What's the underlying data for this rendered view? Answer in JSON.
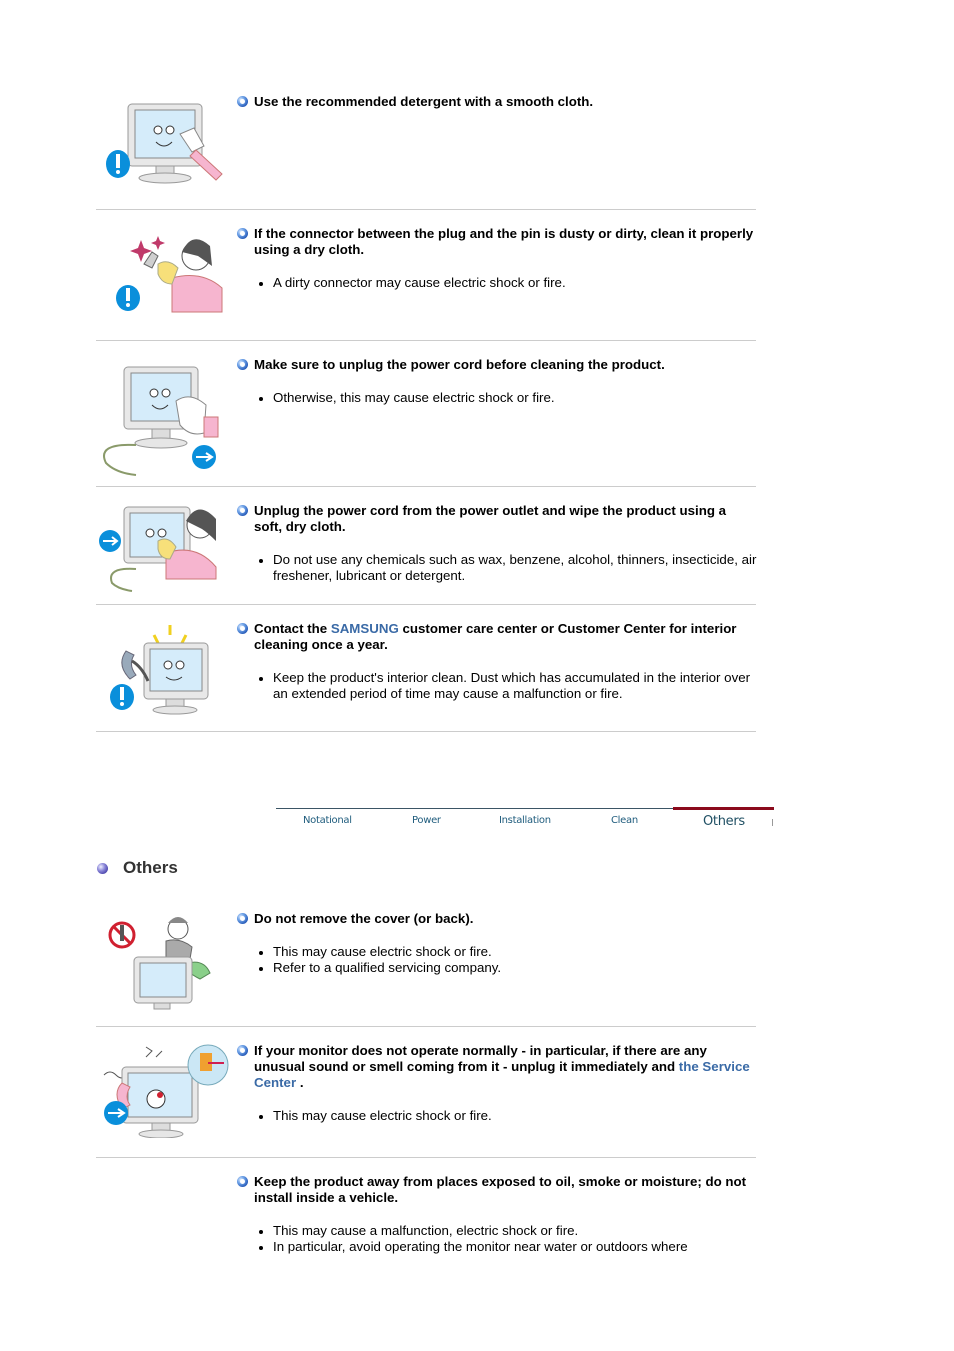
{
  "clean_sections": [
    {
      "illustration": "monitor-wiping-warning-icon",
      "heading_parts": [
        {
          "text": "Use the recommended detergent with a smooth cloth.",
          "link": false
        }
      ],
      "items": []
    },
    {
      "illustration": "woman-cleaning-plug-warning-icon",
      "heading_parts": [
        {
          "text": "If the connector between the plug and the pin is dusty or dirty, clean it properly using a dry cloth.",
          "link": false
        }
      ],
      "items": [
        "A dirty connector may cause electric shock or fire."
      ]
    },
    {
      "illustration": "monitor-unplug-cleaning-icon",
      "heading_parts": [
        {
          "text": "Make sure to unplug the power cord before cleaning the product.",
          "link": false
        }
      ],
      "items": [
        "Otherwise, this may cause electric shock or fire."
      ]
    },
    {
      "illustration": "woman-wiping-monitor-unplug-icon",
      "heading_parts": [
        {
          "text": "Unplug the power cord from the power outlet and wipe the product using a soft, dry cloth.",
          "link": false
        }
      ],
      "items": [
        "Do not use any chemicals such as wax, benzene, alcohol, thinners, insecticide, air freshener, lubricant or detergent."
      ]
    },
    {
      "illustration": "phone-call-service-monitor-icon",
      "heading_parts": [
        {
          "text": "Contact the ",
          "link": false
        },
        {
          "text": "SAMSUNG",
          "link": true
        },
        {
          "text": " customer care center or Customer Center for interior cleaning once a year.",
          "link": false
        }
      ],
      "items": [
        "Keep the product's interior clean. Dust which has accumulated in the interior over an extended period of time may cause a malfunction or fire."
      ]
    }
  ],
  "tabs": [
    {
      "label": "Notational",
      "active": false
    },
    {
      "label": "Power",
      "active": false
    },
    {
      "label": "Installation",
      "active": false
    },
    {
      "label": "Clean",
      "active": false
    },
    {
      "label": "Others",
      "active": true
    }
  ],
  "others": {
    "title": "Others",
    "sections": [
      {
        "illustration": "repairman-no-disassemble-icon",
        "heading_parts": [
          {
            "text": "Do not remove the cover (or back).",
            "link": false
          }
        ],
        "items": [
          "This may cause electric shock or fire.",
          "Refer to a qualified servicing company."
        ]
      },
      {
        "illustration": "smoking-monitor-unplug-icon",
        "heading_parts": [
          {
            "text": "If your monitor does not operate normally - in particular, if there are any unusual sound or smell coming from it - unplug it immediately and ",
            "link": false
          },
          {
            "text": "the Service Center",
            "link": true
          },
          {
            "text": " .",
            "link": false
          }
        ],
        "items": [
          "This may cause electric shock or fire."
        ]
      },
      {
        "illustration": "",
        "heading_parts": [
          {
            "text": "Keep the product away from places exposed to oil, smoke or moisture; do not install inside a vehicle.",
            "link": false
          }
        ],
        "items": [
          "This may cause a malfunction, electric shock or fire.",
          "In particular, avoid operating the monitor near water or outdoors where"
        ]
      }
    ]
  },
  "colors": {
    "link": "#3a6aa6",
    "tab_text": "#1f5c7d",
    "tab_active_bar": "#8b0a1c",
    "divider": "#cccccc"
  }
}
